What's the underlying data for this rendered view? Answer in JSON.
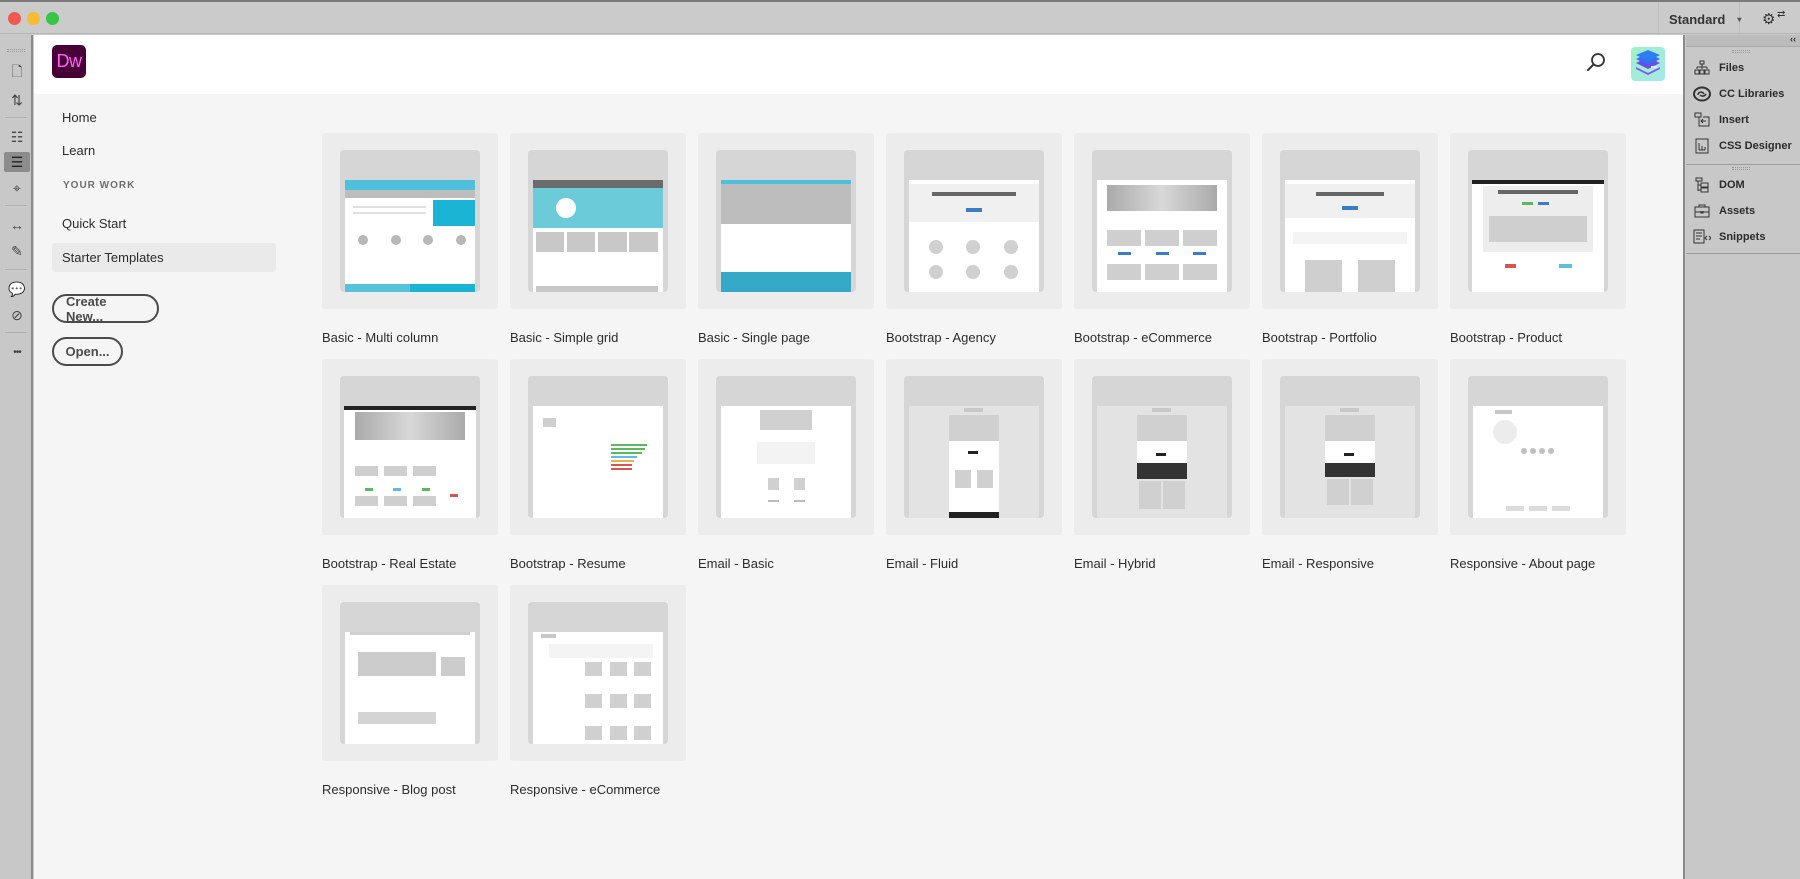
{
  "window": {
    "workspace_label": "Standard",
    "workspace_caret": "▾",
    "settings_icon": "⚙",
    "settings_arrows": "⇄"
  },
  "app": {
    "logo_text": "Dw",
    "colors": {
      "logo_bg": "#470137",
      "logo_text": "#ff61f6",
      "accent_blue": "#3fb1d1"
    }
  },
  "left_toolbar": {
    "tools": [
      {
        "name": "new-file",
        "glyph": "🗋"
      },
      {
        "name": "transfer",
        "glyph": "⇅"
      },
      {
        "name": "inspect",
        "glyph": "☷"
      },
      {
        "name": "format-source",
        "glyph": "☰",
        "active": true
      },
      {
        "name": "target",
        "glyph": "⌖"
      },
      {
        "name": "expand",
        "glyph": "↔"
      },
      {
        "name": "wrap-tag",
        "glyph": "✎"
      },
      {
        "name": "comment",
        "glyph": "💬"
      },
      {
        "name": "remove-comment",
        "glyph": "⊘"
      },
      {
        "name": "more",
        "glyph": "•••"
      }
    ]
  },
  "nav": {
    "home": "Home",
    "learn": "Learn",
    "section": "YOUR WORK",
    "quick_start": "Quick Start",
    "starter_templates": "Starter Templates",
    "create_new": "Create New...",
    "open": "Open..."
  },
  "templates": [
    {
      "label": "Basic - Multi column"
    },
    {
      "label": "Basic - Simple grid"
    },
    {
      "label": "Basic - Single page"
    },
    {
      "label": "Bootstrap - Agency"
    },
    {
      "label": "Bootstrap - eCommerce"
    },
    {
      "label": "Bootstrap - Portfolio"
    },
    {
      "label": "Bootstrap - Product"
    },
    {
      "label": "Bootstrap - Real Estate"
    },
    {
      "label": "Bootstrap - Resume"
    },
    {
      "label": "Email - Basic"
    },
    {
      "label": "Email - Fluid"
    },
    {
      "label": "Email - Hybrid"
    },
    {
      "label": "Email - Responsive"
    },
    {
      "label": "Responsive - About page"
    },
    {
      "label": "Responsive - Blog post"
    },
    {
      "label": "Responsive - eCommerce"
    }
  ],
  "right_panel": {
    "collapse": "‹‹",
    "group1": [
      {
        "label": "Files",
        "icon": "⊞"
      },
      {
        "label": "CC Libraries",
        "icon": "◎"
      },
      {
        "label": "Insert",
        "icon": "⊡"
      },
      {
        "label": "CSS Designer",
        "icon": "▦"
      }
    ],
    "group2": [
      {
        "label": "DOM",
        "icon": "⋮"
      },
      {
        "label": "Assets",
        "icon": "▭"
      },
      {
        "label": "Snippets",
        "icon": "≣"
      }
    ]
  }
}
